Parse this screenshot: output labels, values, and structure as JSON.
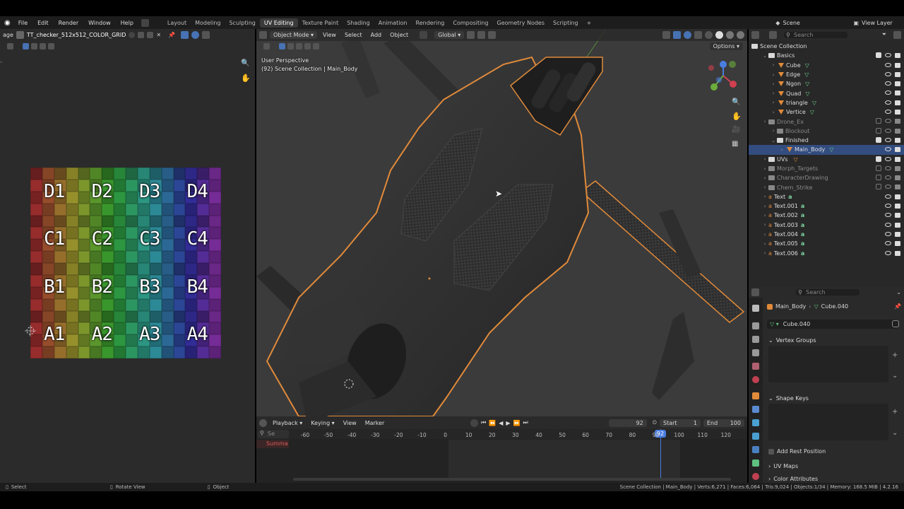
{
  "menubar": {
    "items": [
      "File",
      "Edit",
      "Render",
      "Window",
      "Help"
    ],
    "workspaces": [
      "Layout",
      "Modeling",
      "Sculpting",
      "UV Editing",
      "Texture Paint",
      "Shading",
      "Animation",
      "Rendering",
      "Compositing",
      "Geometry Nodes",
      "Scripting"
    ],
    "active_workspace": "UV Editing",
    "add_tab": "+",
    "scene": "Scene",
    "view_layer": "View Layer"
  },
  "uv_editor": {
    "image_menu": "age",
    "image_name": "TT_checker_512x512_COLOR_GRID",
    "labels": [
      "D1",
      "D2",
      "D3",
      "D4",
      "C1",
      "C2",
      "C3",
      "C4",
      "B1",
      "B2",
      "B3",
      "B4",
      "A1",
      "A2",
      "A3",
      "A4"
    ]
  },
  "viewport": {
    "mode": "Object Mode",
    "menus": [
      "View",
      "Select",
      "Add",
      "Object"
    ],
    "orientation": "Global",
    "options": "Options",
    "view_name": "User Perspective",
    "collection_info": "(92) Scene Collection | Main_Body"
  },
  "timeline": {
    "menus": [
      "Playback",
      "Keying",
      "View",
      "Marker"
    ],
    "current_frame": "92",
    "start_label": "Start",
    "start": "1",
    "end_label": "End",
    "end": "100",
    "ticks": [
      "-60",
      "-50",
      "-40",
      "-30",
      "-20",
      "-10",
      "0",
      "10",
      "20",
      "30",
      "40",
      "50",
      "60",
      "70",
      "80",
      "90",
      "100",
      "110",
      "120"
    ],
    "frame_marker": "92",
    "summary": "Summa",
    "search_placeholder": "Se"
  },
  "outliner": {
    "search_placeholder": "Search",
    "rows": [
      {
        "label": "Scene Collection",
        "kind": "root"
      },
      {
        "label": "Basics",
        "kind": "coll"
      },
      {
        "label": "Cube",
        "kind": "mesh"
      },
      {
        "label": "Edge",
        "kind": "mesh"
      },
      {
        "label": "Ngon",
        "kind": "mesh"
      },
      {
        "label": "Quad",
        "kind": "mesh"
      },
      {
        "label": "triangle",
        "kind": "mesh"
      },
      {
        "label": "Vertice",
        "kind": "mesh"
      },
      {
        "label": "Drone_Ex",
        "kind": "dimcoll"
      },
      {
        "label": "Blockout",
        "kind": "dimcoll"
      },
      {
        "label": "Finished",
        "kind": "coll"
      },
      {
        "label": "Main_Body",
        "kind": "selmesh"
      },
      {
        "label": "UVs",
        "kind": "coll"
      },
      {
        "label": "Morph_Targets",
        "kind": "dimcoll"
      },
      {
        "label": "CharacterDrawing",
        "kind": "dimcoll"
      },
      {
        "label": "Chem_Strike",
        "kind": "dimcoll"
      },
      {
        "label": "Text",
        "kind": "text"
      },
      {
        "label": "Text.001",
        "kind": "text"
      },
      {
        "label": "Text.002",
        "kind": "text"
      },
      {
        "label": "Text.003",
        "kind": "text"
      },
      {
        "label": "Text.004",
        "kind": "text"
      },
      {
        "label": "Text.005",
        "kind": "text"
      },
      {
        "label": "Text.006",
        "kind": "text"
      }
    ]
  },
  "properties": {
    "search_placeholder": "Search",
    "object": "Main_Body",
    "mesh": "Cube.040",
    "datablock": "Cube.040",
    "vertex_groups": "Vertex Groups",
    "shape_keys": "Shape Keys",
    "add_rest": "Add Rest Position",
    "uv_maps": "UV Maps",
    "color_attributes": "Color Attributes"
  },
  "status": {
    "select": "Select",
    "rotate": "Rotate View",
    "object": "Object",
    "info": "Scene Collection | Main_Body | Verts:6,271 | Faces:6,064 | Tris:9,024 | Objects:1/34 | Memory: 168.5 MiB | 4.2.16"
  }
}
